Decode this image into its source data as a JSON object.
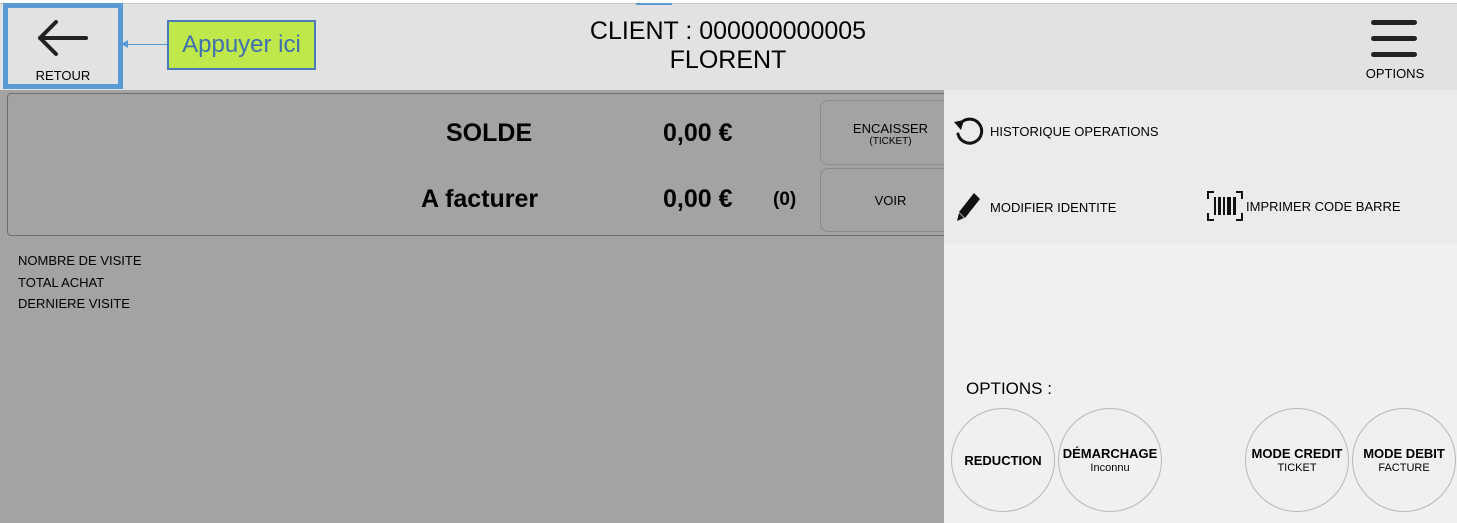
{
  "header": {
    "back_label": "RETOUR",
    "callout_text": "Appuyer ici",
    "client_line": "CLIENT : 000000000005",
    "client_name": "FLORENT",
    "options_label": "OPTIONS"
  },
  "balance": {
    "solde_label": "SOLDE",
    "solde_value": "0,00 €",
    "facturer_label": "A facturer",
    "facturer_value": "0,00 €",
    "facturer_count": "(0)",
    "encaisser_label": "ENCAISSER",
    "encaisser_sub": "(TICKET)",
    "voir_label": "VOIR"
  },
  "stats": {
    "visits_label": "NOMBRE DE VISITE",
    "total_label": "TOTAL ACHAT",
    "last_visit_label": "DERNIERE VISITE"
  },
  "actions": {
    "history_label": "HISTORIQUE OPERATIONS",
    "edit_identity_label": "MODIFIER IDENTITE",
    "print_barcode_label": "IMPRIMER CODE BARRE"
  },
  "options": {
    "heading": "OPTIONS :",
    "reduction_label": "REDUCTION",
    "demarchage_label": "DÉMARCHAGE",
    "demarchage_sub": "Inconnu",
    "credit_label": "MODE CREDIT",
    "credit_sub": "TICKET",
    "debit_label": "MODE DEBIT",
    "debit_sub": "FACTURE"
  },
  "icons": {
    "back": "arrow-left-icon",
    "menu": "hamburger-menu-icon",
    "history": "history-icon",
    "edit": "pencil-icon",
    "barcode": "barcode-icon"
  },
  "colors": {
    "highlight": "#5b9bd5",
    "callout_bg": "#bfe84a",
    "panel_gray": "#a3a3a3"
  }
}
